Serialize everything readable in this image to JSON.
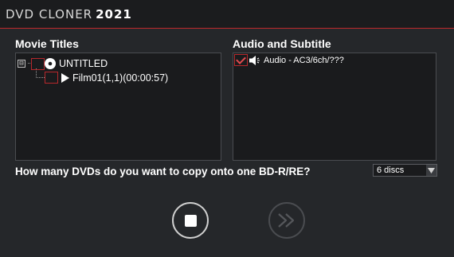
{
  "window": {
    "title": "DVD CLONER",
    "year": "2021"
  },
  "movie_titles": {
    "heading": "Movie Titles",
    "tree": {
      "root_label": "UNTITLED",
      "root_expander": "⊟",
      "root_icon": "disc-icon",
      "child_label": "Film01(1,1)(00:00:57)",
      "child_icon": "play-icon"
    }
  },
  "audio_subtitle": {
    "heading": "Audio and Subtitle",
    "items": [
      {
        "label": "Audio - AC3/6ch/???",
        "checked": true,
        "icon": "speaker-icon"
      }
    ]
  },
  "copy_options": {
    "question": "How many DVDs do you want to copy onto one BD-R/RE?",
    "selected": "6 discs"
  },
  "controls": {
    "stop_icon": "stop-icon",
    "next_icon": "fast-forward-icon"
  },
  "colors": {
    "accent": "#c0282b",
    "background": "#25272a",
    "panel": "#1a1b1d"
  }
}
